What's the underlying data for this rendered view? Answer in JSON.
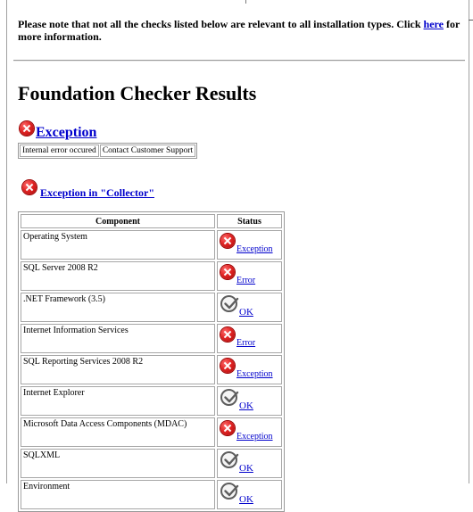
{
  "note": {
    "text_before": "Please note that not all the checks listed below are relevant to all installation types. Click ",
    "link": "here",
    "text_after": " for more information."
  },
  "title": "Foundation Checker Results",
  "exception": {
    "heading": "Exception",
    "icon": "error-icon",
    "cells": [
      "Internal error occured",
      "Contact Customer Support"
    ]
  },
  "collector": {
    "heading": "Exception in \"Collector\"",
    "icon": "error-icon"
  },
  "table": {
    "headers": [
      "Component",
      "Status"
    ],
    "rows": [
      {
        "component": "Operating System",
        "status": "Exception",
        "icon": "error-icon"
      },
      {
        "component": "SQL Server 2008 R2",
        "status": "Error",
        "icon": "error-icon"
      },
      {
        "component": ".NET Framework (3.5)",
        "status": "OK",
        "icon": "ok-check-icon"
      },
      {
        "component": "Internet Information Services",
        "status": "Error",
        "icon": "error-icon"
      },
      {
        "component": "SQL Reporting Services 2008 R2",
        "status": "Exception",
        "icon": "error-icon"
      },
      {
        "component": "Internet Explorer",
        "status": "OK",
        "icon": "ok-check-icon"
      },
      {
        "component": "Microsoft Data Access Components (MDAC)",
        "status": "Exception",
        "icon": "error-icon"
      },
      {
        "component": "SQLXML",
        "status": "OK",
        "icon": "ok-check-icon"
      },
      {
        "component": "Environment",
        "status": "OK",
        "icon": "ok-check-icon"
      }
    ]
  },
  "colors": {
    "link": "#0000cc",
    "error": "#e02424",
    "ok": "#5e5e5e"
  }
}
